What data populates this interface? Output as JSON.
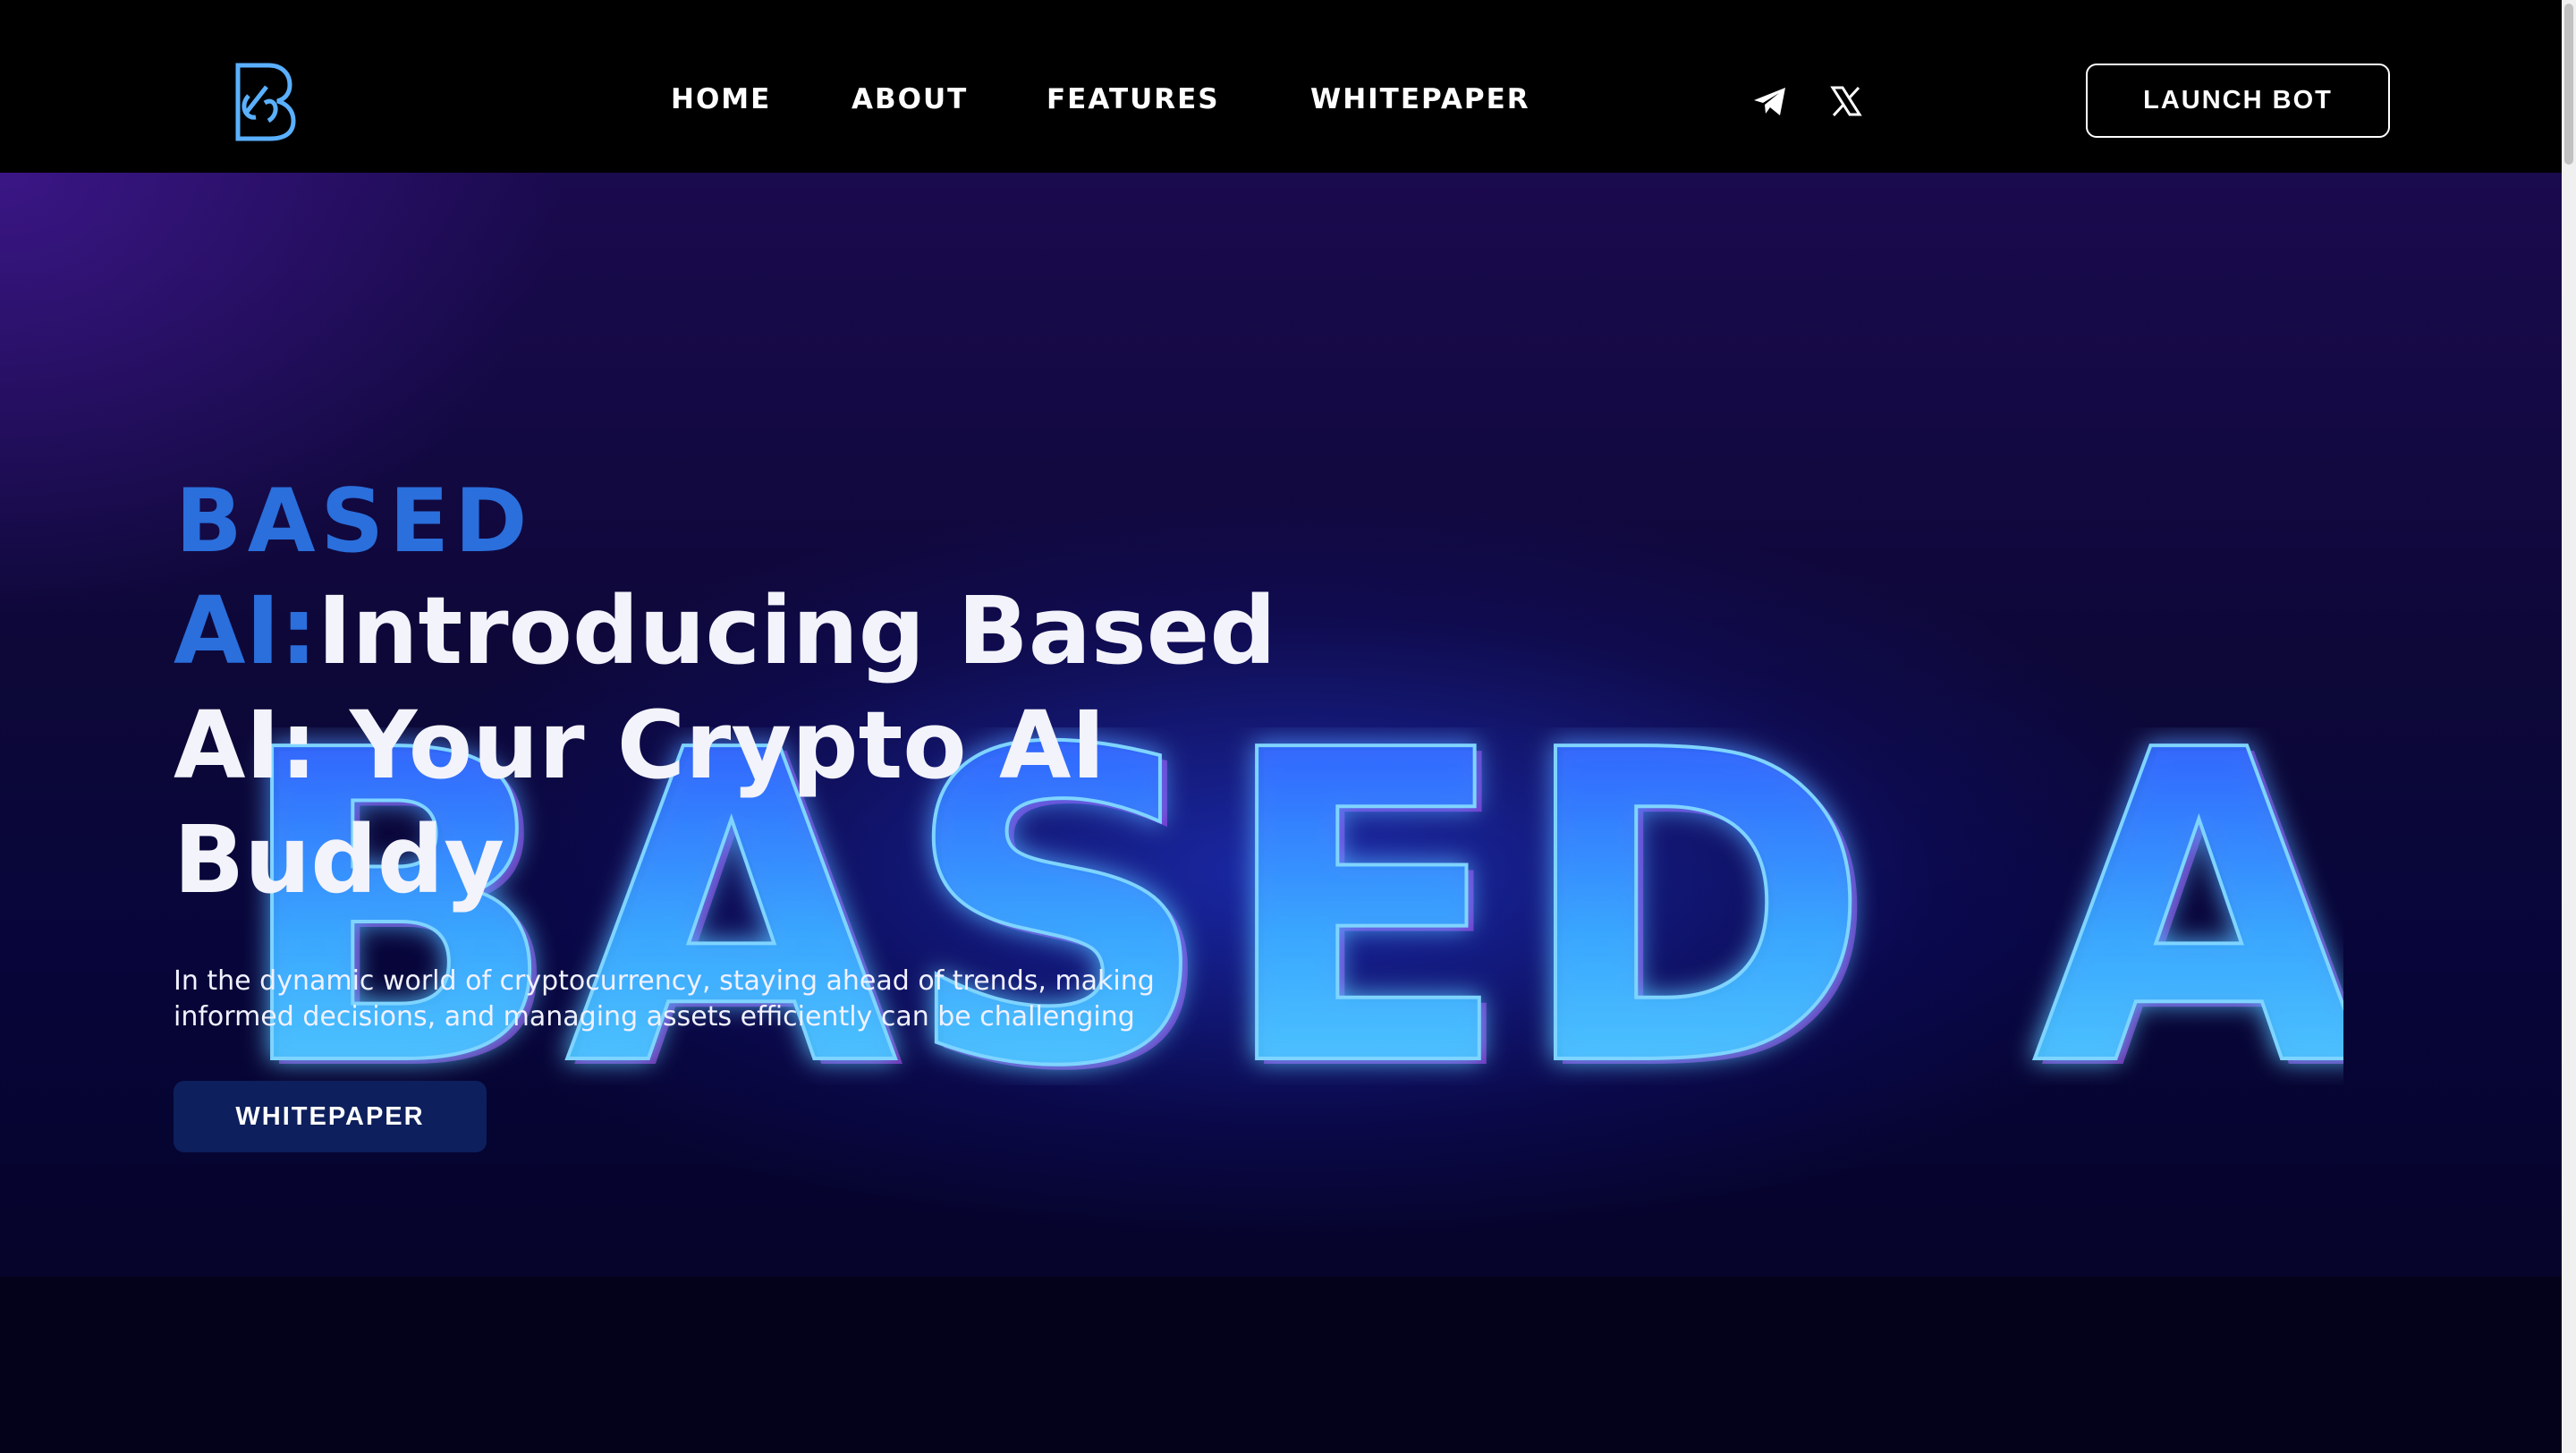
{
  "header": {
    "logo_icon": "based-ai-logo",
    "nav": [
      {
        "label": "Home"
      },
      {
        "label": "About"
      },
      {
        "label": "Features"
      },
      {
        "label": "Whitepaper"
      }
    ],
    "social": [
      {
        "icon": "telegram-icon"
      },
      {
        "icon": "x-icon"
      }
    ],
    "cta_label": "Launch Bot"
  },
  "hero": {
    "brand_word": "BASED",
    "headline_prefix": "AI:",
    "headline": "Introducing Based AI: Your Crypto AI Buddy",
    "description": "In the dynamic world of cryptocurrency, staying ahead of trends, making informed decisions, and managing assets efficiently can be challenging",
    "button_label": "Whitepaper",
    "background_graphic_text": "BASED AI"
  },
  "colors": {
    "accent_blue": "#2a6fdc",
    "button_dark_blue": "#0d1f5c",
    "glow_cyan": "#5ad8ff",
    "glow_blue": "#1f3cff"
  }
}
